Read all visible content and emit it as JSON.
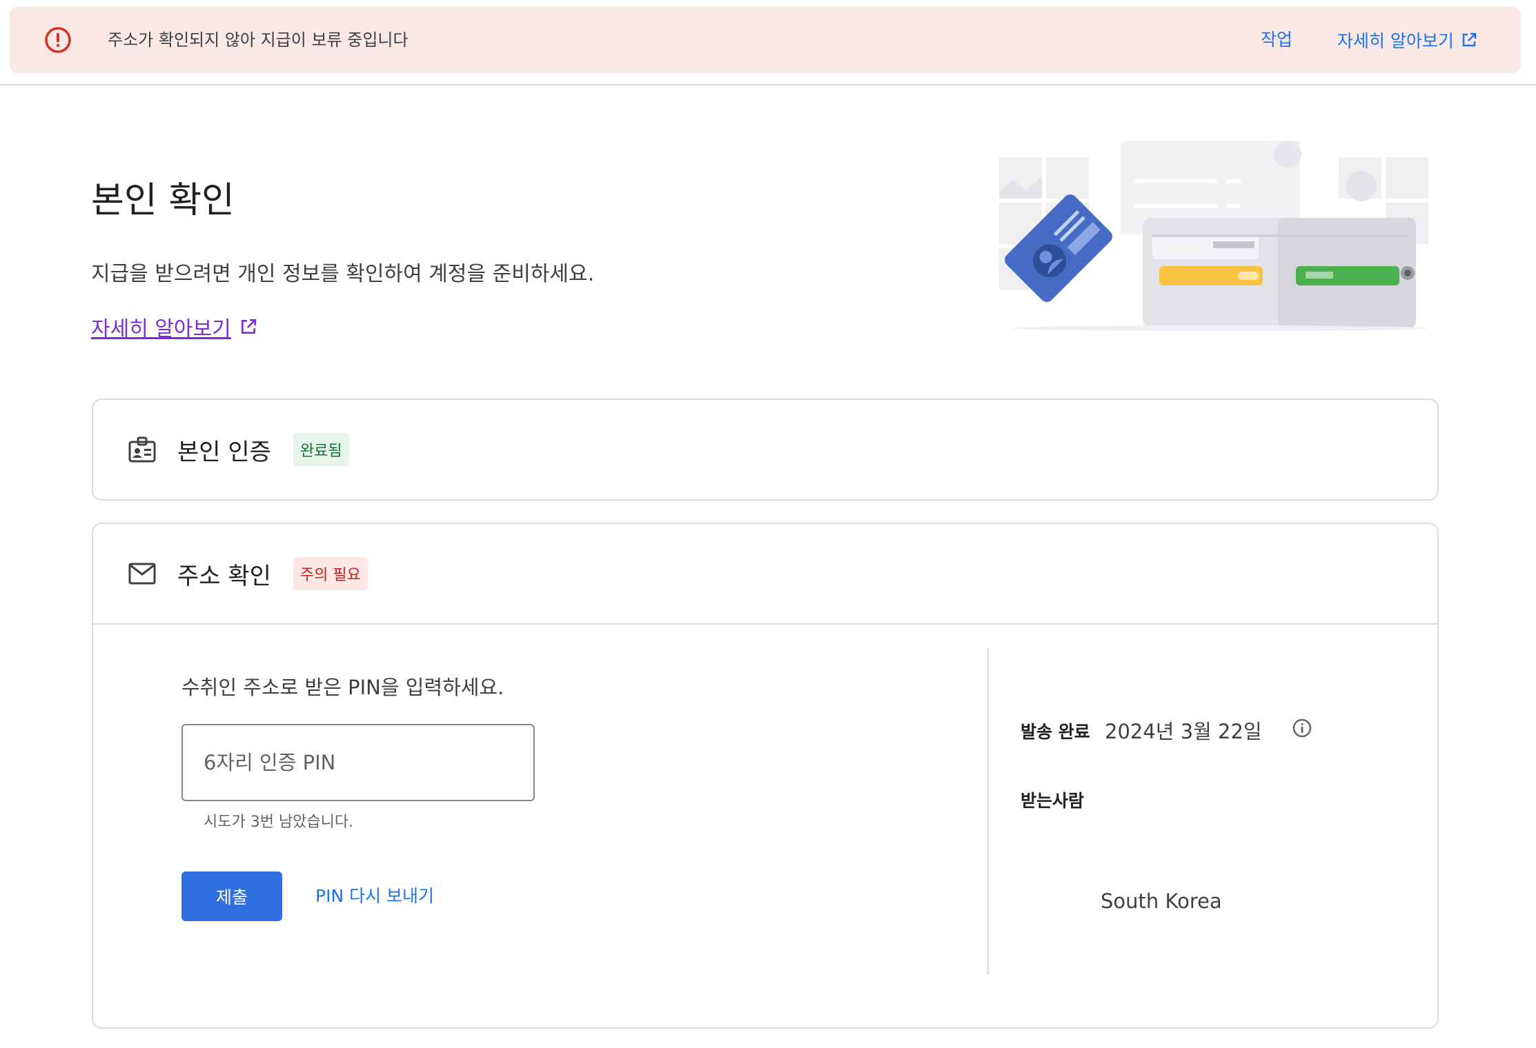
{
  "banner": {
    "message": "주소가 확인되지 않아 지급이 보류 중입니다",
    "action_label": "작업",
    "learn_more_label": "자세히 알아보기",
    "icon": "error-circle-icon",
    "color": "#d93025"
  },
  "header": {
    "title": "본인 확인",
    "subtitle": "지급을 받으려면 개인 정보를 확인하여 계정을 준비하세요.",
    "learn_more_label": "자세히 알아보기"
  },
  "identity_card": {
    "title": "본인 인증",
    "status": "완료됨",
    "icon": "id-badge-icon"
  },
  "address_card": {
    "title": "주소 확인",
    "status": "주의 필요",
    "icon": "mail-icon",
    "prompt": "수취인 주소로 받은 PIN을 입력하세요.",
    "pin_placeholder": "6자리 인증 PIN",
    "attempts_hint": "시도가 3번 남았습니다.",
    "submit_label": "제출",
    "resend_label": "PIN 다시 보내기",
    "sent_label": "발송 완료",
    "sent_date": "2024년 3월 22일",
    "recipient_label": "받는사람",
    "country": "South Korea"
  },
  "colors": {
    "accent": "#1a73e8",
    "primary_button": "#2f6fe0",
    "success": "#137333",
    "warning": "#c5221f",
    "link_visited": "#7b2fd1"
  }
}
